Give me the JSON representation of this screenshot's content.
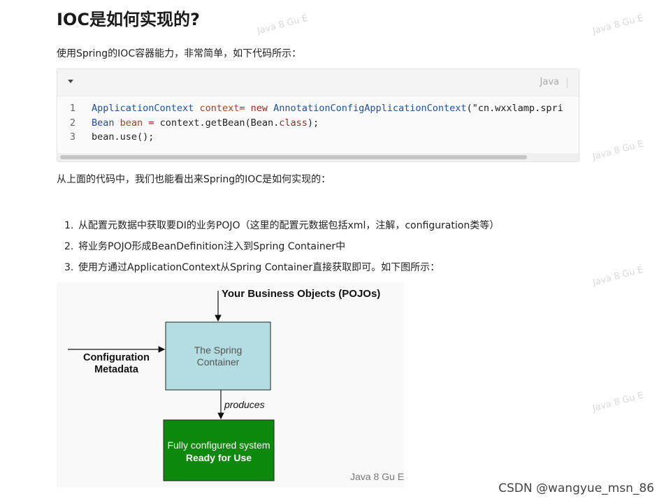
{
  "article": {
    "title": "IOC是如何实现的?",
    "intro": "使用Spring的IOC容器能力，非常简单，如下代码所示：",
    "after_code": "从上面的代码中，我们也能看出来Spring的IOC是如何实现的：",
    "steps": [
      {
        "num": "1.",
        "text": "从配置元数据中获取要DI的业务POJO（这里的配置元数据包括xml，注解，configuration类等）"
      },
      {
        "num": "2.",
        "text": "将业务POJO形成BeanDefinition注入到Spring Container中"
      },
      {
        "num": "3.",
        "text": "使用方通过ApplicationContext从Spring Container直接获取即可。如下图所示："
      }
    ]
  },
  "code": {
    "language": "Java",
    "lines": [
      {
        "n": "1",
        "tokens": [
          {
            "cls": "t-type",
            "text": "ApplicationContext"
          },
          {
            "cls": "t-plain",
            "text": " "
          },
          {
            "cls": "t-var",
            "text": "context"
          },
          {
            "cls": "t-kw",
            "text": "="
          },
          {
            "cls": "t-plain",
            "text": " "
          },
          {
            "cls": "t-kw",
            "text": "new"
          },
          {
            "cls": "t-plain",
            "text": " "
          },
          {
            "cls": "t-type",
            "text": "AnnotationConfigApplicationContext"
          },
          {
            "cls": "t-plain",
            "text": "("
          },
          {
            "cls": "t-str",
            "text": "\"cn.wxxlamp.spri"
          }
        ]
      },
      {
        "n": "2",
        "tokens": [
          {
            "cls": "t-type",
            "text": "Bean"
          },
          {
            "cls": "t-plain",
            "text": " "
          },
          {
            "cls": "t-var",
            "text": "bean"
          },
          {
            "cls": "t-plain",
            "text": " "
          },
          {
            "cls": "t-kw",
            "text": "="
          },
          {
            "cls": "t-plain",
            "text": " context.getBean(Bean."
          },
          {
            "cls": "t-kw",
            "text": "class"
          },
          {
            "cls": "t-plain",
            "text": ");"
          }
        ]
      },
      {
        "n": "3",
        "tokens": [
          {
            "cls": "t-plain",
            "text": "bean.use();"
          }
        ]
      }
    ]
  },
  "diagram": {
    "top_label": "Your Business Objects (POJOs)",
    "left_label_line1": "Configuration",
    "left_label_line2": "Metadata",
    "container_line1": "The Spring",
    "container_line2": "Container",
    "produces": "produces",
    "result_line1": "Fully configured system",
    "result_line2": "Ready for Use",
    "watermark": "Java 8 Gu E",
    "container_color": "#b3dde0",
    "result_color": "#0d8a0d"
  },
  "watermark_text": "Java 8 Gu E",
  "footer_credit": "CSDN @wangyue_msn_86",
  "icons": {
    "collapse": "triangle-down-icon"
  }
}
